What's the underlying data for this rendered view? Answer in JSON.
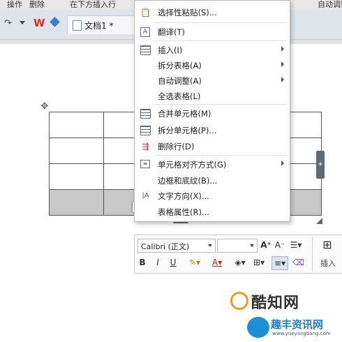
{
  "toolbar": {
    "item1": "操作",
    "item2": "删除",
    "item3": "在下方插入行",
    "item4": "自动调整",
    "wps_label": "W"
  },
  "tab": {
    "doc_name": "文档1 *"
  },
  "context_menu": {
    "items": [
      {
        "label": "选择性粘贴(S)...",
        "icon": "paste-special-icon"
      },
      {
        "label": "翻译(T)",
        "icon": "translate-icon"
      },
      {
        "label": "插入(I)",
        "icon": "table-insert-icon",
        "submenu": true
      },
      {
        "label": "拆分表格(A)",
        "submenu": true
      },
      {
        "label": "自动调整(A)",
        "submenu": true
      },
      {
        "label": "全选表格(L)"
      },
      {
        "label": "合并单元格(M)",
        "icon": "merge-cells-icon"
      },
      {
        "label": "拆分单元格(P)...",
        "icon": "split-cells-icon"
      },
      {
        "label": "删除行(D)",
        "icon": "delete-row-icon"
      },
      {
        "label": "单元格对齐方式(G)",
        "icon": "cell-align-icon",
        "submenu": true
      },
      {
        "label": "边框和底纹(B)..."
      },
      {
        "label": "文字方向(X)...",
        "icon": "text-direction-icon"
      },
      {
        "label": "表格属性(R)..."
      }
    ]
  },
  "mini_toolbar": {
    "font": "Calibri (正文)",
    "size": "",
    "bold": "B",
    "italic": "I",
    "underline": "U",
    "insert": "插入"
  },
  "watermark": {
    "brand1": "酷知网",
    "brand2": "趣丰资讯网",
    "url": "www.yueyangbang.com"
  },
  "colors": {
    "accent": "#1e8fd6",
    "menu_border": "#b9b9b9",
    "selected_row": "#c8c8c8"
  }
}
